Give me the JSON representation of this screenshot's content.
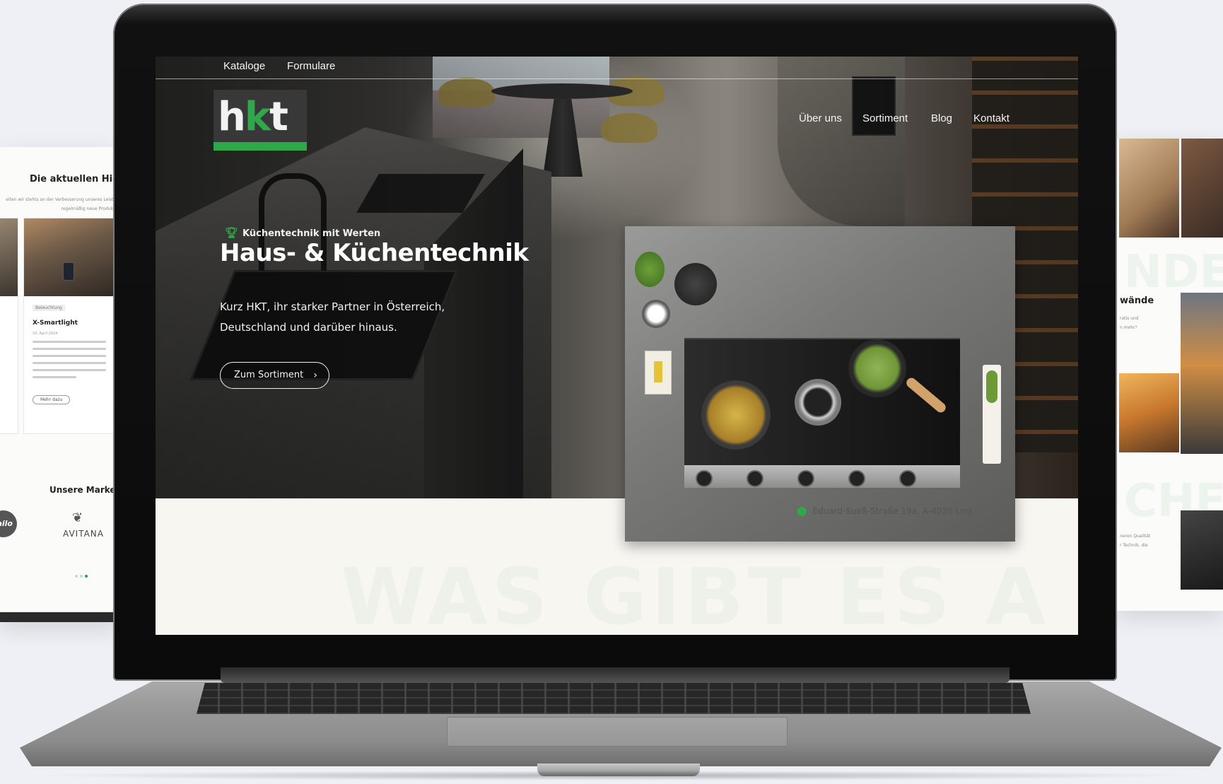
{
  "colors": {
    "brand_green": "#2ea84a",
    "dark_bg": "#2f2f2d",
    "page_bg": "#f8f6f1"
  },
  "left_preview": {
    "title": "Die aktuellen Highl",
    "subtitle_line1": "eiten wir stehts an der Verbesserung unseres Leistun",
    "subtitle_line2": "regelmäßig neue Produkte.",
    "card": {
      "tag": "Beleuchtung",
      "name": "X-Smartlight",
      "date": "23. April 2024",
      "more": "Mehr dazu"
    },
    "brands_title": "Unsere Marken",
    "brand_1": "ailo",
    "brand_2": "AVITANA"
  },
  "right_preview": {
    "big_word_1": "NDE",
    "heading": "wände",
    "text_line1": "ratis und",
    "text_line2": "n mehr?",
    "big_word_2": "CHEN",
    "text_line3": "neren Qualität",
    "text_line4": "r Technik, die"
  },
  "site": {
    "topbar": {
      "kataloge": "Kataloge",
      "formulare": "Formulare"
    },
    "logo": {
      "h": "h",
      "k": "k",
      "t": "t"
    },
    "nav": {
      "ueber_uns": "Über uns",
      "sortiment": "Sortiment",
      "blog": "Blog",
      "kontakt": "Kontakt"
    },
    "hero": {
      "kicker": "Küchentechnik mit Werten",
      "title": "Haus- & Küchentechnik",
      "text": "Kurz HKT, ihr starker Partner in Österreich, Deutschland und darüber hinaus.",
      "cta": "Zum Sortiment"
    },
    "address": "Eduard-Sueß-Straße 19a, A-4020 Linz",
    "watermark": "WAS GIBT ES A"
  },
  "icons": {
    "kicker": "trophy-icon",
    "cta": "chevron-right-icon",
    "address": "map-pin-icon"
  }
}
